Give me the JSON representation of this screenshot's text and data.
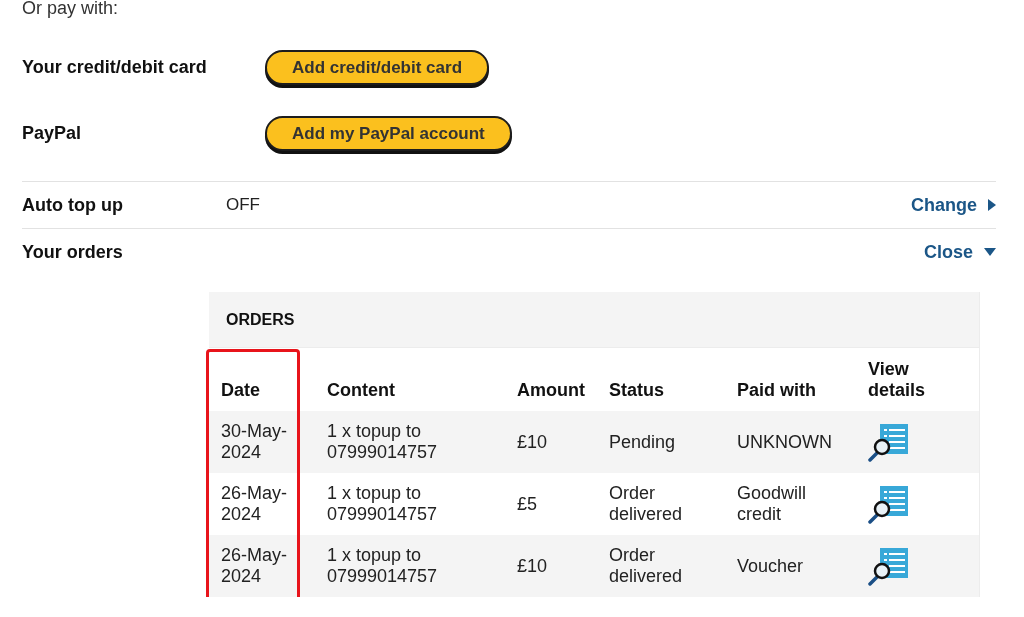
{
  "intro": {
    "text": "Or pay with:"
  },
  "payment_options": [
    {
      "label": "Your credit/debit card",
      "button": "Add credit/debit card"
    },
    {
      "label": "PayPal",
      "button": "Add my PayPal account"
    }
  ],
  "settings": [
    {
      "label": "Auto top up",
      "value": "OFF",
      "link": "Change",
      "expanded": false
    },
    {
      "label": "Your orders",
      "link": "Close",
      "expanded": true
    }
  ],
  "orders": {
    "title": "ORDERS",
    "columns": [
      {
        "label": "Date",
        "kind": "date",
        "highlighted": true
      },
      {
        "label": "Content",
        "kind": "text",
        "highlighted": false
      },
      {
        "label": "Amount",
        "kind": "text",
        "highlighted": false
      },
      {
        "label": "Status",
        "kind": "text",
        "highlighted": false
      },
      {
        "label": "Paid with",
        "kind": "text",
        "highlighted": false
      },
      {
        "label": "View details",
        "kind": "icon",
        "highlighted": false
      }
    ],
    "rows": [
      {
        "cells": [
          "30-May-2024",
          "1 x topup to 07999014757",
          "£10",
          "Pending",
          "UNKNOWN"
        ]
      },
      {
        "cells": [
          "26-May-2024",
          "1 x topup to 07999014757",
          "£5",
          "Order delivered",
          "Goodwill credit"
        ]
      },
      {
        "cells": [
          "26-May-2024",
          "1 x topup to 07999014757",
          "£10",
          "Order delivered",
          "Voucher"
        ]
      }
    ]
  }
}
